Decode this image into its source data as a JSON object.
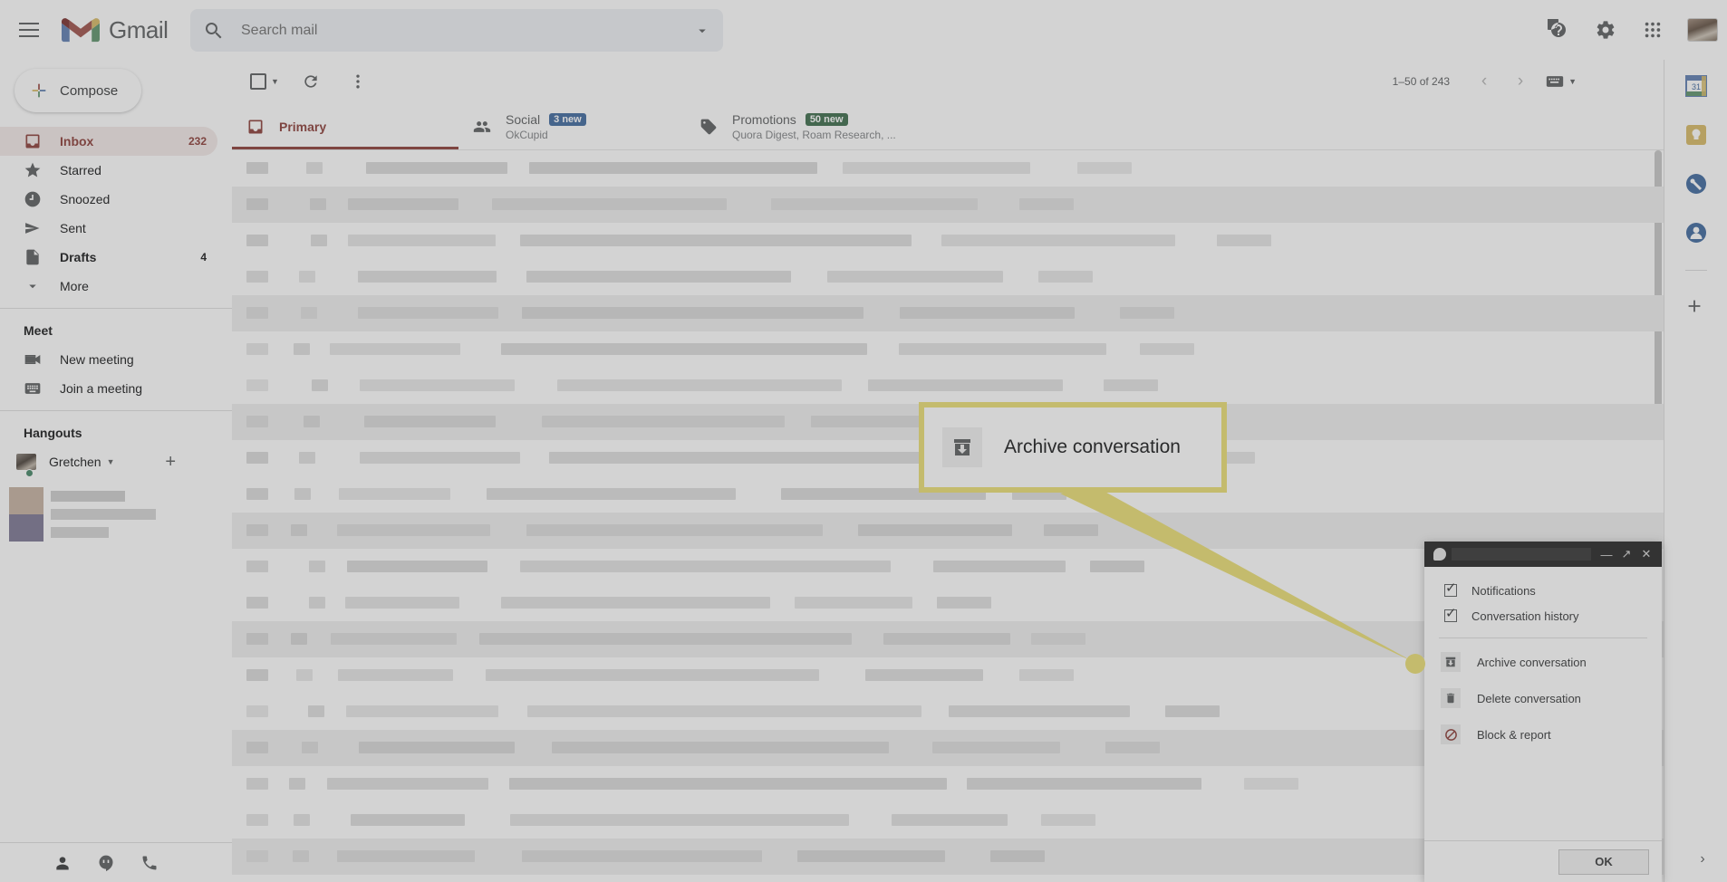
{
  "app": {
    "name": "Gmail",
    "logo_icon": "gmail-logo-icon",
    "menu_icon": "hamburger-menu-icon"
  },
  "search": {
    "placeholder": "Search mail",
    "value": "",
    "search_icon": "search-icon",
    "options_icon": "show-search-options-icon"
  },
  "header_actions": [
    {
      "name": "support-button",
      "icon": "help-circle-icon"
    },
    {
      "name": "settings-button",
      "icon": "gear-icon"
    },
    {
      "name": "google-apps-button",
      "icon": "apps-grid-icon"
    },
    {
      "name": "account-avatar",
      "icon": "avatar-icon"
    }
  ],
  "sidebar": {
    "compose_label": "Compose",
    "compose_icon": "plus-icon",
    "items": [
      {
        "label": "Inbox",
        "count": "232",
        "icon": "inbox-icon",
        "active": true,
        "bold": true
      },
      {
        "label": "Starred",
        "count": "",
        "icon": "star-icon",
        "active": false,
        "bold": false
      },
      {
        "label": "Snoozed",
        "count": "",
        "icon": "clock-icon",
        "active": false,
        "bold": false
      },
      {
        "label": "Sent",
        "count": "",
        "icon": "send-icon",
        "active": false,
        "bold": false
      },
      {
        "label": "Drafts",
        "count": "4",
        "icon": "document-icon",
        "active": false,
        "bold": true
      },
      {
        "label": "More",
        "count": "",
        "icon": "chevron-down-icon",
        "active": false,
        "bold": false
      }
    ],
    "meet": {
      "title": "Meet",
      "items": [
        {
          "label": "New meeting",
          "icon": "video-camera-icon"
        },
        {
          "label": "Join a meeting",
          "icon": "keyboard-icon"
        }
      ]
    },
    "hangouts": {
      "title": "Hangouts",
      "user": "Gretchen",
      "user_caret_icon": "chevron-down-icon",
      "add_icon": "plus-icon",
      "status": "online",
      "footer_icons": [
        "contacts-icon",
        "hangouts-bubble-icon",
        "phone-icon"
      ]
    }
  },
  "toolbar": {
    "select_all_icon": "checkbox-icon",
    "select_caret_icon": "chevron-down-icon",
    "refresh_icon": "refresh-icon",
    "more_icon": "more-vertical-icon",
    "pagination": "1–50 of 243",
    "prev_icon": "chevron-left-icon",
    "next_icon": "chevron-right-icon",
    "input_tools_icon": "keyboard-icon",
    "input_tools_caret_icon": "chevron-down-icon"
  },
  "tabs": [
    {
      "label": "Primary",
      "icon": "inbox-tab-icon",
      "badge": "",
      "badge_color": "",
      "subtitle": "",
      "active": true
    },
    {
      "label": "Social",
      "icon": "people-tab-icon",
      "badge": "3 new",
      "badge_color": "#1a73e8",
      "subtitle": "OkCupid",
      "active": false
    },
    {
      "label": "Promotions",
      "icon": "tag-tab-icon",
      "badge": "50 new",
      "badge_color": "#188038",
      "subtitle": "Quora Digest, Roam Research, ...",
      "active": false
    }
  ],
  "callout": {
    "label": "Archive conversation",
    "icon": "archive-icon",
    "border_color": "#ffe600",
    "pointer_color": "#ffe600"
  },
  "hangouts_popup": {
    "bubble_icon": "hangouts-bubble-icon",
    "window_buttons": [
      {
        "name": "minimize-button",
        "glyph": "—"
      },
      {
        "name": "popout-button",
        "glyph": "↗"
      },
      {
        "name": "close-button",
        "glyph": "✕"
      }
    ],
    "checkboxes": [
      {
        "label": "Notifications",
        "checked": true
      },
      {
        "label": "Conversation history",
        "checked": true
      }
    ],
    "menu_items": [
      {
        "label": "Archive conversation",
        "icon": "archive-icon"
      },
      {
        "label": "Delete conversation",
        "icon": "trash-icon"
      },
      {
        "label": "Block & report",
        "icon": "block-icon"
      }
    ],
    "ok_label": "OK"
  },
  "right_rail": {
    "items": [
      {
        "name": "calendar-icon",
        "label": "31"
      },
      {
        "name": "keep-icon",
        "label": ""
      },
      {
        "name": "tasks-icon",
        "label": ""
      },
      {
        "name": "contacts-icon",
        "label": ""
      }
    ],
    "add_icon": "plus-icon",
    "expand_icon": "chevron-right-icon"
  }
}
